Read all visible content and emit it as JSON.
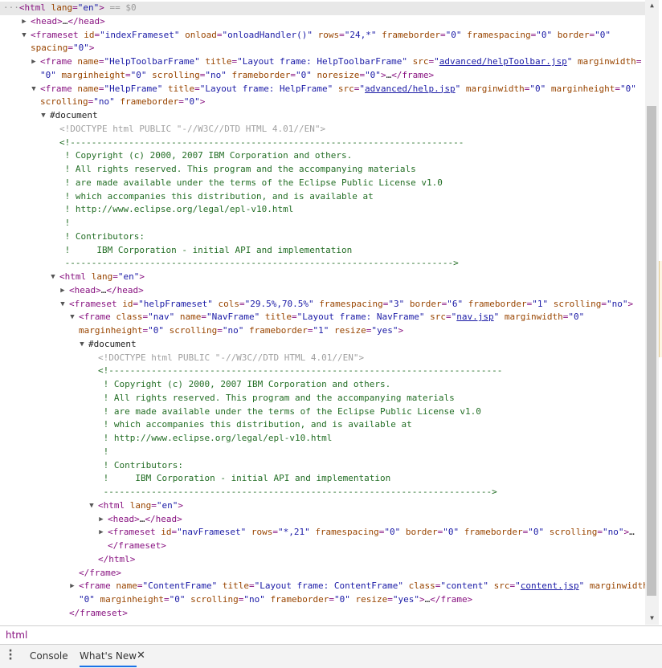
{
  "elements_tree": [
    {
      "indent": 0,
      "tw": "",
      "selected": true,
      "parts": [
        [
          "dim",
          "···"
        ],
        [
          "tag",
          "<html "
        ],
        [
          "an",
          "lang"
        ],
        [
          "tag",
          "="
        ],
        [
          "av",
          "\"en\""
        ],
        [
          "tag",
          ">"
        ],
        [
          "dim",
          " == $0"
        ]
      ]
    },
    {
      "indent": 1,
      "tw": "▶",
      "parts": [
        [
          "tag",
          "<head>"
        ],
        [
          "tx",
          "…"
        ],
        [
          "tag",
          "</head>"
        ]
      ]
    },
    {
      "indent": 1,
      "tw": "▼",
      "parts": [
        [
          "tag",
          "<frameset "
        ],
        [
          "an",
          "id"
        ],
        [
          "tag",
          "="
        ],
        [
          "av",
          "\"indexFrameset\" "
        ],
        [
          "an",
          "onload"
        ],
        [
          "tag",
          "="
        ],
        [
          "av",
          "\"onloadHandler()\" "
        ],
        [
          "an",
          "rows"
        ],
        [
          "tag",
          "="
        ],
        [
          "av",
          "\"24,*\" "
        ],
        [
          "an",
          "frameborder"
        ],
        [
          "tag",
          "="
        ],
        [
          "av",
          "\"0\" "
        ],
        [
          "an",
          "framespacing"
        ],
        [
          "tag",
          "="
        ],
        [
          "av",
          "\"0\" "
        ],
        [
          "an",
          "border"
        ],
        [
          "tag",
          "="
        ],
        [
          "av",
          "\"0\""
        ]
      ]
    },
    {
      "indent": 1,
      "tw": "",
      "cont": true,
      "parts": [
        [
          "an",
          "spacing"
        ],
        [
          "tag",
          "="
        ],
        [
          "av",
          "\"0\""
        ],
        [
          "tag",
          ">"
        ]
      ]
    },
    {
      "indent": 2,
      "tw": "▶",
      "parts": [
        [
          "tag",
          "<frame "
        ],
        [
          "an",
          "name"
        ],
        [
          "tag",
          "="
        ],
        [
          "av",
          "\"HelpToolbarFrame\" "
        ],
        [
          "an",
          "title"
        ],
        [
          "tag",
          "="
        ],
        [
          "av",
          "\"Layout frame: HelpToolbarFrame\" "
        ],
        [
          "an",
          "src"
        ],
        [
          "tag",
          "="
        ],
        [
          "av",
          "\""
        ],
        [
          "lk",
          "advanced/helpToolbar.jsp"
        ],
        [
          "av",
          "\" "
        ],
        [
          "an",
          "marginwidth"
        ],
        [
          "tag",
          "="
        ]
      ]
    },
    {
      "indent": 2,
      "tw": "",
      "cont": true,
      "parts": [
        [
          "av",
          "\"0\" "
        ],
        [
          "an",
          "marginheight"
        ],
        [
          "tag",
          "="
        ],
        [
          "av",
          "\"0\" "
        ],
        [
          "an",
          "scrolling"
        ],
        [
          "tag",
          "="
        ],
        [
          "av",
          "\"no\" "
        ],
        [
          "an",
          "frameborder"
        ],
        [
          "tag",
          "="
        ],
        [
          "av",
          "\"0\" "
        ],
        [
          "an",
          "noresize"
        ],
        [
          "tag",
          "="
        ],
        [
          "av",
          "\"0\""
        ],
        [
          "tag",
          ">"
        ],
        [
          "tx",
          "…"
        ],
        [
          "tag",
          "</frame>"
        ]
      ]
    },
    {
      "indent": 2,
      "tw": "▼",
      "parts": [
        [
          "tag",
          "<frame "
        ],
        [
          "an",
          "name"
        ],
        [
          "tag",
          "="
        ],
        [
          "av",
          "\"HelpFrame\" "
        ],
        [
          "an",
          "title"
        ],
        [
          "tag",
          "="
        ],
        [
          "av",
          "\"Layout frame: HelpFrame\" "
        ],
        [
          "an",
          "src"
        ],
        [
          "tag",
          "="
        ],
        [
          "av",
          "\""
        ],
        [
          "lk",
          "advanced/help.jsp"
        ],
        [
          "av",
          "\" "
        ],
        [
          "an",
          "marginwidth"
        ],
        [
          "tag",
          "="
        ],
        [
          "av",
          "\"0\" "
        ],
        [
          "an",
          "marginheight"
        ],
        [
          "tag",
          "="
        ],
        [
          "av",
          "\"0\""
        ]
      ]
    },
    {
      "indent": 2,
      "tw": "",
      "cont": true,
      "parts": [
        [
          "an",
          "scrolling"
        ],
        [
          "tag",
          "="
        ],
        [
          "av",
          "\"no\" "
        ],
        [
          "an",
          "frameborder"
        ],
        [
          "tag",
          "="
        ],
        [
          "av",
          "\"0\""
        ],
        [
          "tag",
          ">"
        ]
      ]
    },
    {
      "indent": 3,
      "tw": "▼",
      "parts": [
        [
          "tx",
          "#document"
        ]
      ]
    },
    {
      "indent": 4,
      "tw": "",
      "parts": [
        [
          "dt",
          "<!DOCTYPE html PUBLIC \"-//W3C//DTD HTML 4.01//EN\">"
        ]
      ]
    },
    {
      "indent": 4,
      "tw": "",
      "parts": [
        [
          "cm",
          "<!--------------------------------------------------------------------------"
        ]
      ]
    },
    {
      "indent": 4,
      "tw": "",
      "parts": [
        [
          "cm",
          " ! Copyright (c) 2000, 2007 IBM Corporation and others."
        ]
      ]
    },
    {
      "indent": 4,
      "tw": "",
      "parts": [
        [
          "cm",
          " ! All rights reserved. This program and the accompanying materials"
        ]
      ]
    },
    {
      "indent": 4,
      "tw": "",
      "parts": [
        [
          "cm",
          " ! are made available under the terms of the Eclipse Public License v1.0"
        ]
      ]
    },
    {
      "indent": 4,
      "tw": "",
      "parts": [
        [
          "cm",
          " ! which accompanies this distribution, and is available at"
        ]
      ]
    },
    {
      "indent": 4,
      "tw": "",
      "parts": [
        [
          "cm",
          " ! http://www.eclipse.org/legal/epl-v10.html"
        ]
      ]
    },
    {
      "indent": 4,
      "tw": "",
      "parts": [
        [
          "cm",
          " !"
        ]
      ]
    },
    {
      "indent": 4,
      "tw": "",
      "parts": [
        [
          "cm",
          " ! Contributors:"
        ]
      ]
    },
    {
      "indent": 4,
      "tw": "",
      "parts": [
        [
          "cm",
          " !     IBM Corporation - initial API and implementation"
        ]
      ]
    },
    {
      "indent": 4,
      "tw": "",
      "parts": [
        [
          "cm",
          " ------------------------------------------------------------------------->"
        ]
      ]
    },
    {
      "indent": 4,
      "tw": "▼",
      "parts": [
        [
          "tag",
          "<html "
        ],
        [
          "an",
          "lang"
        ],
        [
          "tag",
          "="
        ],
        [
          "av",
          "\"en\""
        ],
        [
          "tag",
          ">"
        ]
      ]
    },
    {
      "indent": 5,
      "tw": "▶",
      "parts": [
        [
          "tag",
          "<head>"
        ],
        [
          "tx",
          "…"
        ],
        [
          "tag",
          "</head>"
        ]
      ]
    },
    {
      "indent": 5,
      "tw": "▼",
      "parts": [
        [
          "tag",
          "<frameset "
        ],
        [
          "an",
          "id"
        ],
        [
          "tag",
          "="
        ],
        [
          "av",
          "\"helpFrameset\" "
        ],
        [
          "an",
          "cols"
        ],
        [
          "tag",
          "="
        ],
        [
          "av",
          "\"29.5%,70.5%\" "
        ],
        [
          "an",
          "framespacing"
        ],
        [
          "tag",
          "="
        ],
        [
          "av",
          "\"3\" "
        ],
        [
          "an",
          "border"
        ],
        [
          "tag",
          "="
        ],
        [
          "av",
          "\"6\" "
        ],
        [
          "an",
          "frameborder"
        ],
        [
          "tag",
          "="
        ],
        [
          "av",
          "\"1\" "
        ],
        [
          "an",
          "scrolling"
        ],
        [
          "tag",
          "="
        ],
        [
          "av",
          "\"no\""
        ],
        [
          "tag",
          ">"
        ]
      ]
    },
    {
      "indent": 6,
      "tw": "▼",
      "parts": [
        [
          "tag",
          "<frame "
        ],
        [
          "an",
          "class"
        ],
        [
          "tag",
          "="
        ],
        [
          "av",
          "\"nav\" "
        ],
        [
          "an",
          "name"
        ],
        [
          "tag",
          "="
        ],
        [
          "av",
          "\"NavFrame\" "
        ],
        [
          "an",
          "title"
        ],
        [
          "tag",
          "="
        ],
        [
          "av",
          "\"Layout frame: NavFrame\" "
        ],
        [
          "an",
          "src"
        ],
        [
          "tag",
          "="
        ],
        [
          "av",
          "\""
        ],
        [
          "lk",
          "nav.jsp"
        ],
        [
          "av",
          "\" "
        ],
        [
          "an",
          "marginwidth"
        ],
        [
          "tag",
          "="
        ],
        [
          "av",
          "\"0\""
        ]
      ]
    },
    {
      "indent": 6,
      "tw": "",
      "cont": true,
      "parts": [
        [
          "an",
          "marginheight"
        ],
        [
          "tag",
          "="
        ],
        [
          "av",
          "\"0\" "
        ],
        [
          "an",
          "scrolling"
        ],
        [
          "tag",
          "="
        ],
        [
          "av",
          "\"no\" "
        ],
        [
          "an",
          "frameborder"
        ],
        [
          "tag",
          "="
        ],
        [
          "av",
          "\"1\" "
        ],
        [
          "an",
          "resize"
        ],
        [
          "tag",
          "="
        ],
        [
          "av",
          "\"yes\""
        ],
        [
          "tag",
          ">"
        ]
      ]
    },
    {
      "indent": 7,
      "tw": "▼",
      "parts": [
        [
          "tx",
          "#document"
        ]
      ]
    },
    {
      "indent": 8,
      "tw": "",
      "parts": [
        [
          "dt",
          "<!DOCTYPE html PUBLIC \"-//W3C//DTD HTML 4.01//EN\">"
        ]
      ]
    },
    {
      "indent": 8,
      "tw": "",
      "parts": [
        [
          "cm",
          "<!--------------------------------------------------------------------------"
        ]
      ]
    },
    {
      "indent": 8,
      "tw": "",
      "parts": [
        [
          "cm",
          " ! Copyright (c) 2000, 2007 IBM Corporation and others."
        ]
      ]
    },
    {
      "indent": 8,
      "tw": "",
      "parts": [
        [
          "cm",
          " ! All rights reserved. This program and the accompanying materials"
        ]
      ]
    },
    {
      "indent": 8,
      "tw": "",
      "parts": [
        [
          "cm",
          " ! are made available under the terms of the Eclipse Public License v1.0"
        ]
      ]
    },
    {
      "indent": 8,
      "tw": "",
      "parts": [
        [
          "cm",
          " ! which accompanies this distribution, and is available at"
        ]
      ]
    },
    {
      "indent": 8,
      "tw": "",
      "parts": [
        [
          "cm",
          " ! http://www.eclipse.org/legal/epl-v10.html"
        ]
      ]
    },
    {
      "indent": 8,
      "tw": "",
      "parts": [
        [
          "cm",
          " !"
        ]
      ]
    },
    {
      "indent": 8,
      "tw": "",
      "parts": [
        [
          "cm",
          " ! Contributors:"
        ]
      ]
    },
    {
      "indent": 8,
      "tw": "",
      "parts": [
        [
          "cm",
          " !     IBM Corporation - initial API and implementation"
        ]
      ]
    },
    {
      "indent": 8,
      "tw": "",
      "parts": [
        [
          "cm",
          " ------------------------------------------------------------------------->"
        ]
      ]
    },
    {
      "indent": 8,
      "tw": "▼",
      "parts": [
        [
          "tag",
          "<html "
        ],
        [
          "an",
          "lang"
        ],
        [
          "tag",
          "="
        ],
        [
          "av",
          "\"en\""
        ],
        [
          "tag",
          ">"
        ]
      ]
    },
    {
      "indent": 9,
      "tw": "▶",
      "parts": [
        [
          "tag",
          "<head>"
        ],
        [
          "tx",
          "…"
        ],
        [
          "tag",
          "</head>"
        ]
      ]
    },
    {
      "indent": 9,
      "tw": "▶",
      "parts": [
        [
          "tag",
          "<frameset "
        ],
        [
          "an",
          "id"
        ],
        [
          "tag",
          "="
        ],
        [
          "av",
          "\"navFrameset\" "
        ],
        [
          "an",
          "rows"
        ],
        [
          "tag",
          "="
        ],
        [
          "av",
          "\"*,21\" "
        ],
        [
          "an",
          "framespacing"
        ],
        [
          "tag",
          "="
        ],
        [
          "av",
          "\"0\" "
        ],
        [
          "an",
          "border"
        ],
        [
          "tag",
          "="
        ],
        [
          "av",
          "\"0\" "
        ],
        [
          "an",
          "frameborder"
        ],
        [
          "tag",
          "="
        ],
        [
          "av",
          "\"0\" "
        ],
        [
          "an",
          "scrolling"
        ],
        [
          "tag",
          "="
        ],
        [
          "av",
          "\"no\""
        ],
        [
          "tag",
          ">"
        ],
        [
          "tx",
          "…"
        ]
      ]
    },
    {
      "indent": 9,
      "tw": "",
      "parts": [
        [
          "tag",
          "</frameset>"
        ]
      ]
    },
    {
      "indent": 8,
      "tw": "",
      "parts": [
        [
          "tag",
          "</html>"
        ]
      ]
    },
    {
      "indent": 6,
      "tw": "",
      "parts": [
        [
          "tag",
          "</frame>"
        ]
      ]
    },
    {
      "indent": 6,
      "tw": "▶",
      "parts": [
        [
          "tag",
          "<frame "
        ],
        [
          "an",
          "name"
        ],
        [
          "tag",
          "="
        ],
        [
          "av",
          "\"ContentFrame\" "
        ],
        [
          "an",
          "title"
        ],
        [
          "tag",
          "="
        ],
        [
          "av",
          "\"Layout frame: ContentFrame\" "
        ],
        [
          "an",
          "class"
        ],
        [
          "tag",
          "="
        ],
        [
          "av",
          "\"content\" "
        ],
        [
          "an",
          "src"
        ],
        [
          "tag",
          "="
        ],
        [
          "av",
          "\""
        ],
        [
          "lk",
          "content.jsp"
        ],
        [
          "av",
          "\" "
        ],
        [
          "an",
          "marginwidth"
        ],
        [
          "tag",
          "="
        ]
      ]
    },
    {
      "indent": 6,
      "tw": "",
      "cont": true,
      "parts": [
        [
          "av",
          "\"0\" "
        ],
        [
          "an",
          "marginheight"
        ],
        [
          "tag",
          "="
        ],
        [
          "av",
          "\"0\" "
        ],
        [
          "an",
          "scrolling"
        ],
        [
          "tag",
          "="
        ],
        [
          "av",
          "\"no\" "
        ],
        [
          "an",
          "frameborder"
        ],
        [
          "tag",
          "="
        ],
        [
          "av",
          "\"0\" "
        ],
        [
          "an",
          "resize"
        ],
        [
          "tag",
          "="
        ],
        [
          "av",
          "\"yes\""
        ],
        [
          "tag",
          ">"
        ],
        [
          "tx",
          "…"
        ],
        [
          "tag",
          "</frame>"
        ]
      ]
    },
    {
      "indent": 5,
      "tw": "",
      "parts": [
        [
          "tag",
          "</frameset>"
        ]
      ]
    }
  ],
  "syntax_colors": {
    "tag": "#881280",
    "attr_name": "#994500",
    "attr_value": "#1a1aa6",
    "comment": "#236e25",
    "doctype": "#a0a0a0"
  },
  "breadcrumb": {
    "item": "html"
  },
  "drawer": {
    "menu_icon": "kebab-menu-icon",
    "tabs": [
      {
        "label": "Console",
        "active": false
      },
      {
        "label": "What's New",
        "active": true,
        "closable": true
      }
    ],
    "close_glyph": "✕"
  }
}
